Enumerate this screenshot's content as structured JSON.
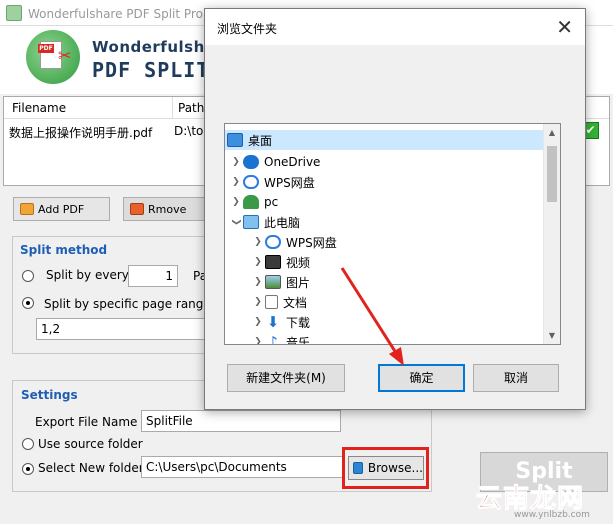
{
  "app": {
    "title": "Wonderfulshare PDF Split Pro（Unregistered）",
    "brand_line1": "Wonderfulshare",
    "brand_line2": "PDF SPLIT",
    "help_letter": "p"
  },
  "file_table": {
    "columns": [
      "Filename",
      "Path"
    ],
    "rows": [
      {
        "filename": "数据上报操作说明手册.pdf",
        "path": "D:\\to"
      }
    ],
    "check_mark": "✔"
  },
  "toolbar": {
    "add_label": "Add PDF",
    "remove_label": "Rmove"
  },
  "split_method": {
    "title": "Split method",
    "by_every_label": "Split by every",
    "by_every_value": "1",
    "pa_fragment": "Pa",
    "by_ranges_label": "Split by specific page ranges t",
    "ranges_value": "1,2"
  },
  "settings": {
    "title": "Settings",
    "export_label": "Export File Name",
    "export_value": "SplitFile",
    "use_source_label": "Use source folder",
    "select_new_label": "Select New folder",
    "folder_value": "C:\\Users\\pc\\Documents",
    "browse_label": "Browse..."
  },
  "split_button": "Split",
  "watermark": {
    "text": "云南龙网",
    "url": "www.ynlbzb.com"
  },
  "dialog": {
    "title": "浏览文件夹",
    "close_glyph": "✕",
    "tree": [
      {
        "label": "桌面"
      },
      {
        "label": "OneDrive"
      },
      {
        "label": "WPS网盘"
      },
      {
        "label": "pc"
      },
      {
        "label": "此电脑"
      },
      {
        "label": "WPS网盘"
      },
      {
        "label": "视频"
      },
      {
        "label": "图片"
      },
      {
        "label": "文档"
      },
      {
        "label": "下载"
      },
      {
        "label": "音乐"
      }
    ],
    "new_folder_label": "新建文件夹(M)",
    "ok_label": "确定",
    "cancel_label": "取消"
  },
  "colors": {
    "accent_blue": "#1e5fb5",
    "highlight_red": "#e2221c",
    "selection": "#cce8ff",
    "ok_border": "#0078d7"
  }
}
